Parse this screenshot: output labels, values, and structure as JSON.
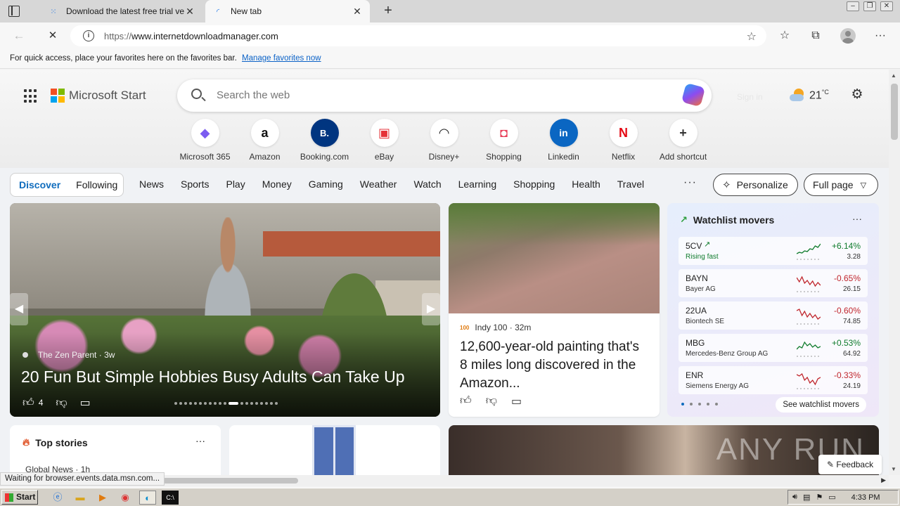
{
  "browser": {
    "tabs": [
      {
        "title": "Download the latest free trial ve",
        "active": false
      },
      {
        "title": "New tab",
        "active": true
      }
    ],
    "address": {
      "protocol": "https://",
      "host": "www.internetdownloadmanager.com"
    },
    "favorites_bar": {
      "text": "For quick access, place your favorites here on the favorites bar.",
      "link": "Manage favorites now"
    },
    "status_text": "Waiting for browser.events.data.msn.com..."
  },
  "header": {
    "brand": "Microsoft Start",
    "search_placeholder": "Search the web",
    "signin": "Sign in",
    "temperature": "21",
    "temp_unit": "°C"
  },
  "shortcuts": [
    {
      "label": "Microsoft 365",
      "glyph": "◆",
      "color": "#7b5cf0"
    },
    {
      "label": "Amazon",
      "glyph": "a",
      "color": "#111111"
    },
    {
      "label": "Booking.com",
      "glyph": "B.",
      "color": "#ffffff"
    },
    {
      "label": "eBay",
      "glyph": "▣",
      "color": "#e53238"
    },
    {
      "label": "Disney+",
      "glyph": "◠",
      "color": "#1b1b1b"
    },
    {
      "label": "Shopping",
      "glyph": "◘",
      "color": "#e8405a"
    },
    {
      "label": "Linkedin",
      "glyph": "in",
      "color": "#ffffff"
    },
    {
      "label": "Netflix",
      "glyph": "N",
      "color": "#e50914"
    },
    {
      "label": "Add shortcut",
      "glyph": "+",
      "color": "#333333"
    }
  ],
  "nav": {
    "discover": "Discover",
    "following": "Following",
    "categories": [
      "News",
      "Sports",
      "Play",
      "Money",
      "Gaming",
      "Weather",
      "Watch",
      "Learning",
      "Shopping",
      "Health",
      "Travel"
    ],
    "more": "···",
    "personalize": "Personalize",
    "full_page": "Full page"
  },
  "hero": {
    "source": "The Zen Parent",
    "age": "3w",
    "headline": "20 Fun But Simple Hobbies Busy Adults Can Take Up",
    "likes": "4"
  },
  "article": {
    "logo": "100",
    "source": "Indy 100",
    "age": "32m",
    "title": "12,600-year-old painting that's 8 miles long discovered in the Amazon..."
  },
  "watchlist": {
    "title": "Watchlist movers",
    "more": "···",
    "see_all": "See watchlist movers",
    "stocks": [
      {
        "symbol": "5CV",
        "name": "Rising fast",
        "change": "+6.14%",
        "price": "3.28",
        "trend": "up",
        "spark": [
          16,
          14,
          15,
          12,
          13,
          9,
          10,
          5,
          7,
          2
        ]
      },
      {
        "symbol": "BAYN",
        "name": "Bayer AG",
        "change": "-0.65%",
        "price": "26.15",
        "trend": "down",
        "spark": [
          4,
          10,
          3,
          12,
          8,
          14,
          9,
          16,
          11,
          15
        ]
      },
      {
        "symbol": "22UA",
        "name": "Biontech SE",
        "change": "-0.60%",
        "price": "74.85",
        "trend": "down",
        "spark": [
          5,
          3,
          12,
          6,
          14,
          9,
          15,
          11,
          17,
          14
        ]
      },
      {
        "symbol": "MBG",
        "name": "Mercedes-Benz Group AG",
        "change": "+0.53%",
        "price": "64.92",
        "trend": "up",
        "spark": [
          14,
          10,
          12,
          4,
          9,
          6,
          11,
          8,
          12,
          10
        ]
      },
      {
        "symbol": "ENR",
        "name": "Siemens Energy AG",
        "change": "-0.33%",
        "price": "24.19",
        "trend": "down",
        "spark": [
          4,
          6,
          3,
          12,
          8,
          16,
          12,
          18,
          10,
          8
        ]
      }
    ]
  },
  "bottom": {
    "top_stories": "Top stories",
    "top_stories_more": "···",
    "first_source": "Global News",
    "first_age": "1h",
    "feedback": "Feedback",
    "watermark": "ANY RUN"
  },
  "taskbar": {
    "start": "Start",
    "clock": "4:33 PM"
  }
}
